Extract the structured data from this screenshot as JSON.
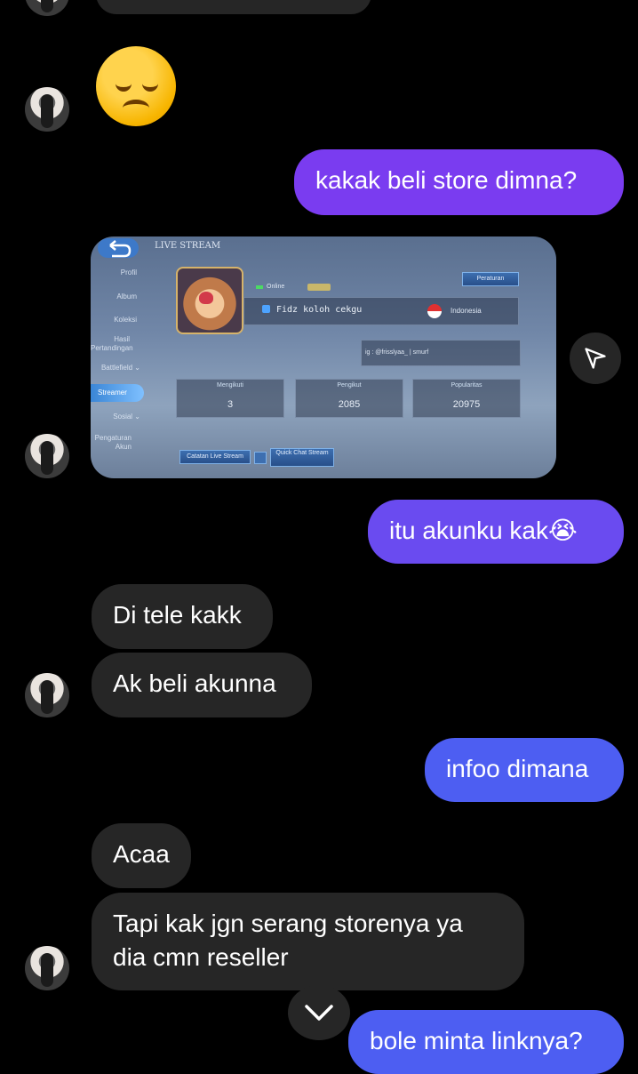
{
  "messages": {
    "m1": "kakak beli store dimna?",
    "m2": "itu akunku kak😭",
    "m3": "Di tele kakk",
    "m4": "Ak beli akunna",
    "m5": "infoo dimana",
    "m6": "Acaa",
    "m7": "Tapi kak jgn serang storenya ya\ndia cmn reseller",
    "m8": "bole minta linknya?"
  },
  "game": {
    "header": "LIVE STREAM",
    "sidebar": [
      "Profil",
      "Album",
      "Koleksi",
      "Hasil Pertandingan",
      "Battlefield ⌄",
      "Streamer",
      "Sosial ⌄",
      "Pengaturan Akun"
    ],
    "status": "Online",
    "rules_button": "Peraturan",
    "player_name": "Fidz koloh cekgu",
    "country": "Indonesia",
    "bio": "ig : @frisslyaa_ | smurf",
    "stats": [
      {
        "label": "Mengikuti",
        "value": "3"
      },
      {
        "label": "Pengikut",
        "value": "2085"
      },
      {
        "label": "Popularitas",
        "value": "20975"
      }
    ],
    "btn_history": "Catatan Live Stream",
    "btn_quick": "Quick Chat Stream"
  },
  "icons": {
    "share": "paper-plane-icon",
    "scroll": "chevron-down-icon",
    "reaction": "disappointed-face-emoji"
  },
  "colors": {
    "incoming": "#262626",
    "outgoing_purple": "#7a3cf0",
    "outgoing_violet": "#6a4bf0",
    "outgoing_blue": "#4d5ef2"
  }
}
